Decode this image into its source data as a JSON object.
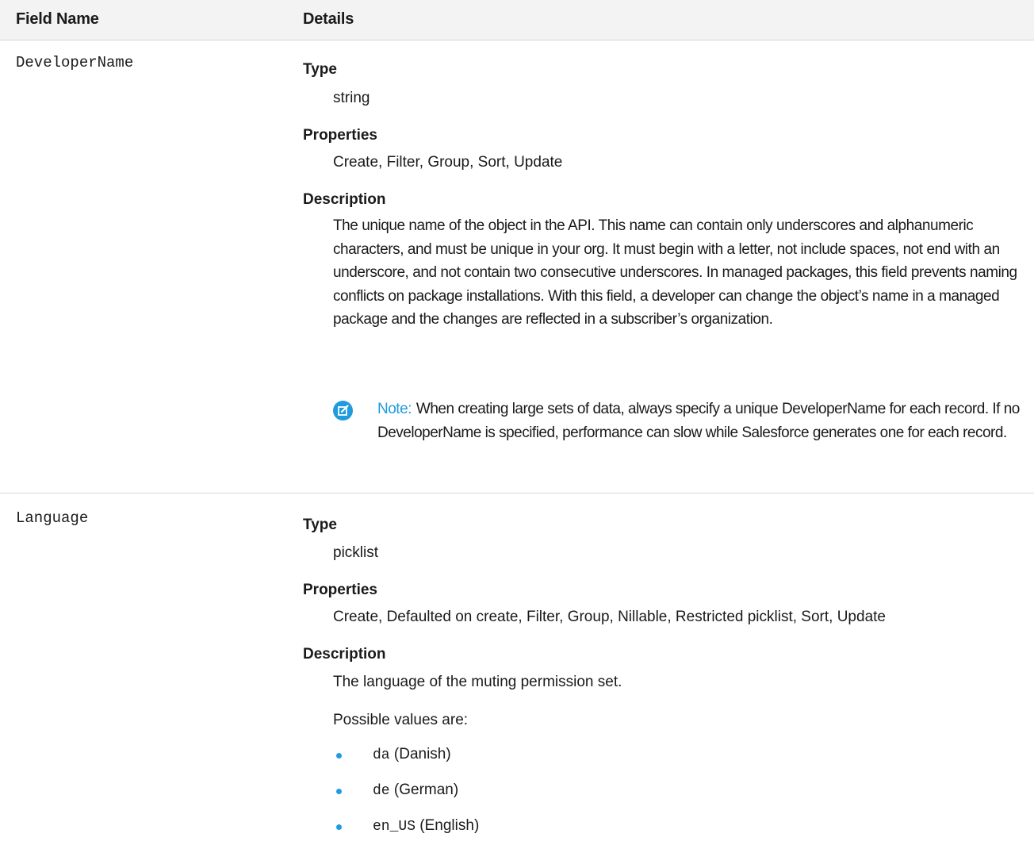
{
  "table": {
    "header": {
      "field_name": "Field Name",
      "details": "Details"
    },
    "labels": {
      "type": "Type",
      "properties": "Properties",
      "description": "Description"
    },
    "rows": [
      {
        "field": "DeveloperName",
        "type": "string",
        "properties": "Create, Filter, Group, Sort, Update",
        "description": "The unique name of the object in the API. This name can contain only underscores and alphanumeric characters, and must be unique in your org. It must begin with a letter, not include spaces, not end with an underscore, and not contain two consecutive underscores. In managed packages, this field prevents naming conflicts on package installations. With this field, a developer can change the object’s name in a managed package and the changes are reflected in a subscriber’s organization.",
        "note": {
          "label": "Note:",
          "icon": "edit-note-icon",
          "text": "When creating large sets of data, always specify a unique DeveloperName for each record. If no DeveloperName is specified, performance can slow while Salesforce generates one for each record."
        }
      },
      {
        "field": "Language",
        "type": "picklist",
        "properties": "Create, Defaulted on create, Filter, Group, Nillable, Restricted picklist, Sort, Update",
        "description": "The language of the muting permission set.",
        "possible_values_intro": "Possible values are:",
        "values": [
          {
            "code": "da",
            "label": "(Danish)"
          },
          {
            "code": "de",
            "label": "(German)"
          },
          {
            "code": "en_US",
            "label": "(English)"
          }
        ]
      }
    ]
  },
  "colors": {
    "accent": "#1f9bde",
    "header_bg": "#f3f3f3",
    "divider": "#d8d8d8"
  }
}
